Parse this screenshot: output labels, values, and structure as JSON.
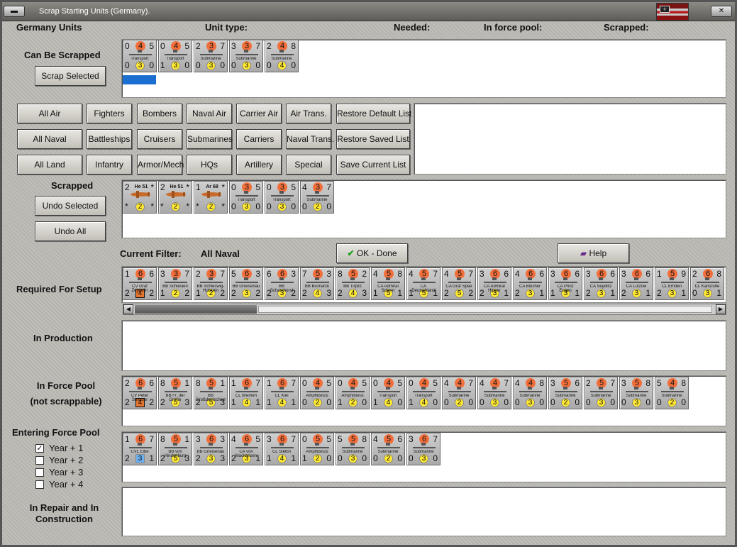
{
  "window": {
    "title": "Scrap Starting Units (Germany).",
    "system_btn": "▬",
    "close_btn": "✕"
  },
  "header": {
    "country": "Germany Units",
    "unit_type": "Unit type:",
    "needed": "Needed:",
    "in_force_pool": "In force pool:",
    "scrapped": "Scrapped:"
  },
  "can_be_scrapped": {
    "label": "Can Be Scrapped",
    "button": "Scrap Selected"
  },
  "filters": {
    "row1": [
      "All Air",
      "Fighters",
      "Bombers",
      "Naval Air",
      "Carrier Air",
      "Air Trans.",
      "Restore Default List"
    ],
    "row2": [
      "All Naval",
      "Battleships",
      "Cruisers",
      "Submarines",
      "Carriers",
      "Naval Trans.",
      "Restore Saved List"
    ],
    "row3": [
      "All Land",
      "Infantry",
      "Armor/Mech",
      "HQs",
      "Artillery",
      "Special",
      "Save Current List"
    ]
  },
  "scrapped_section": {
    "label": "Scrapped",
    "undo_selected": "Undo Selected",
    "undo_all": "Undo All"
  },
  "current_filter": {
    "label": "Current Filter:",
    "value": "All Naval"
  },
  "ok_button": "OK - Done",
  "help_button": "Help",
  "sections": {
    "required": "Required For Setup",
    "production": "In Production",
    "force_pool_1": "In Force Pool",
    "force_pool_2": "(not scrappable)",
    "entering": "Entering Force Pool",
    "repair_1": "In Repair and In",
    "repair_2": "Construction"
  },
  "years": [
    {
      "label": "Year + 1",
      "checked": true
    },
    {
      "label": "Year + 2",
      "checked": false
    },
    {
      "label": "Year + 3",
      "checked": false
    },
    {
      "label": "Year + 4",
      "checked": false
    }
  ],
  "units": {
    "scrappable": [
      {
        "tl": "0",
        "tc": "4",
        "tr": "5",
        "bl": "0",
        "bc": "3",
        "br": "0",
        "name": "Transport",
        "kind": "ship"
      },
      {
        "tl": "0",
        "tc": "4",
        "tr": "5",
        "bl": "1",
        "bc": "3",
        "br": "0",
        "name": "Transport",
        "kind": "ship"
      },
      {
        "tl": "2",
        "tc": "3",
        "tr": "7",
        "bl": "0",
        "bc": "3",
        "br": "0",
        "name": "Submarine",
        "kind": "ship"
      },
      {
        "tl": "3",
        "tc": "3",
        "tr": "7",
        "bl": "0",
        "bc": "3",
        "br": "0",
        "name": "Submarine",
        "kind": "ship"
      },
      {
        "tl": "2",
        "tc": "4",
        "tr": "8",
        "bl": "0",
        "bc": "4",
        "br": "0",
        "name": "Submarine",
        "kind": "ship"
      }
    ],
    "scrapped": [
      {
        "tl": "2",
        "tc": "He 51",
        "tr": "*",
        "bl": "*",
        "bc": "2",
        "br": "*",
        "name": "",
        "kind": "plane"
      },
      {
        "tl": "2",
        "tc": "He 51",
        "tr": "*",
        "bl": "*",
        "bc": "2",
        "br": "*",
        "name": "",
        "kind": "plane"
      },
      {
        "tl": "1",
        "tc": "Ar 68",
        "tr": "*",
        "bl": "*",
        "bc": "2",
        "br": "*",
        "name": "",
        "kind": "plane"
      },
      {
        "tl": "0",
        "tc": "3",
        "tr": "5",
        "bl": "0",
        "bc": "3",
        "br": "0",
        "name": "Transport",
        "kind": "ship"
      },
      {
        "tl": "0",
        "tc": "3",
        "tr": "5",
        "bl": "0",
        "bc": "3",
        "br": "0",
        "name": "Transport",
        "kind": "ship"
      },
      {
        "tl": "4",
        "tc": "3",
        "tr": "7",
        "bl": "0",
        "bc": "2",
        "br": "0",
        "name": "Submarine",
        "kind": "ship"
      }
    ],
    "required": [
      {
        "tl": "1",
        "tc": "6",
        "tr": "6",
        "bl": "2",
        "bc": "4",
        "br": "2",
        "name": "CV Graf Zeppelin",
        "kind": "ship",
        "sel": true
      },
      {
        "tl": "3",
        "tc": "3",
        "tr": "7",
        "bl": "1",
        "bc": "2",
        "br": "2",
        "name": "BB Schlesien",
        "kind": "ship"
      },
      {
        "tl": "2",
        "tc": "3",
        "tr": "7",
        "bl": "1",
        "bc": "2",
        "br": "2",
        "name": "BB Schleswig-Holstein",
        "kind": "ship"
      },
      {
        "tl": "5",
        "tc": "6",
        "tr": "3",
        "bl": "2",
        "bc": "3",
        "br": "2",
        "name": "BB Gneisenau",
        "kind": "ship"
      },
      {
        "tl": "6",
        "tc": "6",
        "tr": "3",
        "bl": "2",
        "bc": "3",
        "br": "2",
        "name": "BB Scharnhorst",
        "kind": "ship"
      },
      {
        "tl": "7",
        "tc": "5",
        "tr": "3",
        "bl": "2",
        "bc": "4",
        "br": "3",
        "name": "BB Bismarck",
        "kind": "ship"
      },
      {
        "tl": "8",
        "tc": "5",
        "tr": "2",
        "bl": "2",
        "bc": "4",
        "br": "3",
        "name": "BB Tirpitz",
        "kind": "ship"
      },
      {
        "tl": "4",
        "tc": "5",
        "tr": "8",
        "bl": "1",
        "bc": "5",
        "br": "1",
        "name": "CA Admiral Scheer",
        "kind": "ship"
      },
      {
        "tl": "4",
        "tc": "5",
        "tr": "7",
        "bl": "1",
        "bc": "5",
        "br": "1",
        "name": "CA Deutschland",
        "kind": "ship"
      },
      {
        "tl": "4",
        "tc": "5",
        "tr": "7",
        "bl": "2",
        "bc": "5",
        "br": "2",
        "name": "CA Graf Spee",
        "kind": "ship"
      },
      {
        "tl": "3",
        "tc": "6",
        "tr": "6",
        "bl": "2",
        "bc": "3",
        "br": "1",
        "name": "CA Admiral Hipper",
        "kind": "ship"
      },
      {
        "tl": "4",
        "tc": "6",
        "tr": "6",
        "bl": "2",
        "bc": "3",
        "br": "1",
        "name": "CA Blücher",
        "kind": "ship"
      },
      {
        "tl": "3",
        "tc": "6",
        "tr": "6",
        "bl": "1",
        "bc": "3",
        "br": "1",
        "name": "CA Prinz Eugen",
        "kind": "ship"
      },
      {
        "tl": "3",
        "tc": "6",
        "tr": "6",
        "bl": "2",
        "bc": "3",
        "br": "1",
        "name": "CA Seydlitz",
        "kind": "ship"
      },
      {
        "tl": "3",
        "tc": "6",
        "tr": "6",
        "bl": "2",
        "bc": "3",
        "br": "1",
        "name": "CA Lützow",
        "kind": "ship"
      },
      {
        "tl": "1",
        "tc": "5",
        "tr": "9",
        "bl": "2",
        "bc": "3",
        "br": "1",
        "name": "CL Emden",
        "kind": "ship"
      },
      {
        "tl": "2",
        "tc": "6",
        "tr": "8",
        "bl": "0",
        "bc": "3",
        "br": "1",
        "name": "CL Karlsruhe",
        "kind": "ship"
      }
    ],
    "force_pool": [
      {
        "tl": "2",
        "tc": "6",
        "tr": "6",
        "bl": "2",
        "bc": "4",
        "br": "2",
        "name": "CV Peter Strasser",
        "kind": "ship",
        "sel": true
      },
      {
        "tl": "8",
        "tc": "5",
        "tr": "1",
        "bl": "2",
        "bc": "5",
        "br": "3",
        "name": "BB Fr. der Große",
        "kind": "ship"
      },
      {
        "tl": "8",
        "tc": "5",
        "tr": "1",
        "bl": "2",
        "bc": "5",
        "br": "3",
        "name": "BB Großdeutschland",
        "kind": "ship"
      },
      {
        "tl": "1",
        "tc": "6",
        "tr": "7",
        "bl": "1",
        "bc": "4",
        "br": "1",
        "name": "CL Bremen",
        "kind": "ship"
      },
      {
        "tl": "1",
        "tc": "6",
        "tr": "7",
        "bl": "1",
        "bc": "4",
        "br": "1",
        "name": "CL Kiel",
        "kind": "ship"
      },
      {
        "tl": "0",
        "tc": "4",
        "tr": "5",
        "bl": "0",
        "bc": "2",
        "br": "0",
        "name": "Amphibious",
        "kind": "ship"
      },
      {
        "tl": "0",
        "tc": "4",
        "tr": "5",
        "bl": "1",
        "bc": "2",
        "br": "0",
        "name": "Amphibious",
        "kind": "ship"
      },
      {
        "tl": "0",
        "tc": "4",
        "tr": "5",
        "bl": "1",
        "bc": "4",
        "br": "0",
        "name": "Transport",
        "kind": "ship"
      },
      {
        "tl": "0",
        "tc": "4",
        "tr": "5",
        "bl": "1",
        "bc": "4",
        "br": "0",
        "name": "Transport",
        "kind": "ship"
      },
      {
        "tl": "4",
        "tc": "4",
        "tr": "7",
        "bl": "0",
        "bc": "2",
        "br": "0",
        "name": "Submarine",
        "kind": "ship"
      },
      {
        "tl": "4",
        "tc": "4",
        "tr": "7",
        "bl": "0",
        "bc": "3",
        "br": "0",
        "name": "Submarine",
        "kind": "ship"
      },
      {
        "tl": "4",
        "tc": "4",
        "tr": "8",
        "bl": "0",
        "bc": "3",
        "br": "0",
        "name": "Submarine",
        "kind": "ship"
      },
      {
        "tl": "3",
        "tc": "5",
        "tr": "6",
        "bl": "0",
        "bc": "2",
        "br": "0",
        "name": "Submarine",
        "kind": "ship"
      },
      {
        "tl": "2",
        "tc": "5",
        "tr": "7",
        "bl": "0",
        "bc": "3",
        "br": "0",
        "name": "Submarine",
        "kind": "ship"
      },
      {
        "tl": "3",
        "tc": "5",
        "tr": "8",
        "bl": "0",
        "bc": "3",
        "br": "0",
        "name": "Submarine",
        "kind": "ship"
      },
      {
        "tl": "5",
        "tc": "4",
        "tr": "8",
        "bl": "0",
        "bc": "2",
        "br": "0",
        "name": "Submarine",
        "kind": "ship"
      }
    ],
    "entering": [
      {
        "tl": "1",
        "tc": "6",
        "tr": "7",
        "bl": "2",
        "bc": "3",
        "br": "1",
        "name": "CVL Elbe",
        "kind": "ship",
        "blue": true
      },
      {
        "tl": "8",
        "tc": "5",
        "tr": "1",
        "bl": "2",
        "bc": "5",
        "br": "3",
        "name": "BB von Hindenburg",
        "kind": "ship"
      },
      {
        "tl": "3",
        "tc": "6",
        "tr": "3",
        "bl": "2",
        "bc": "3",
        "br": "3",
        "name": "BB Gneisenau",
        "kind": "ship"
      },
      {
        "tl": "4",
        "tc": "6",
        "tr": "5",
        "bl": "2",
        "bc": "3",
        "br": "1",
        "name": "CA von Mackensen",
        "kind": "ship"
      },
      {
        "tl": "3",
        "tc": "6",
        "tr": "7",
        "bl": "1",
        "bc": "4",
        "br": "1",
        "name": "CL Stettin",
        "kind": "ship"
      },
      {
        "tl": "0",
        "tc": "5",
        "tr": "5",
        "bl": "1",
        "bc": "2",
        "br": "0",
        "name": "Amphibious",
        "kind": "ship"
      },
      {
        "tl": "5",
        "tc": "5",
        "tr": "8",
        "bl": "0",
        "bc": "3",
        "br": "0",
        "name": "Submarine",
        "kind": "ship"
      },
      {
        "tl": "4",
        "tc": "5",
        "tr": "6",
        "bl": "0",
        "bc": "2",
        "br": "0",
        "name": "Submarine",
        "kind": "ship"
      },
      {
        "tl": "3",
        "tc": "6",
        "tr": "7",
        "bl": "0",
        "bc": "3",
        "br": "0",
        "name": "Submarine",
        "kind": "ship"
      }
    ]
  }
}
